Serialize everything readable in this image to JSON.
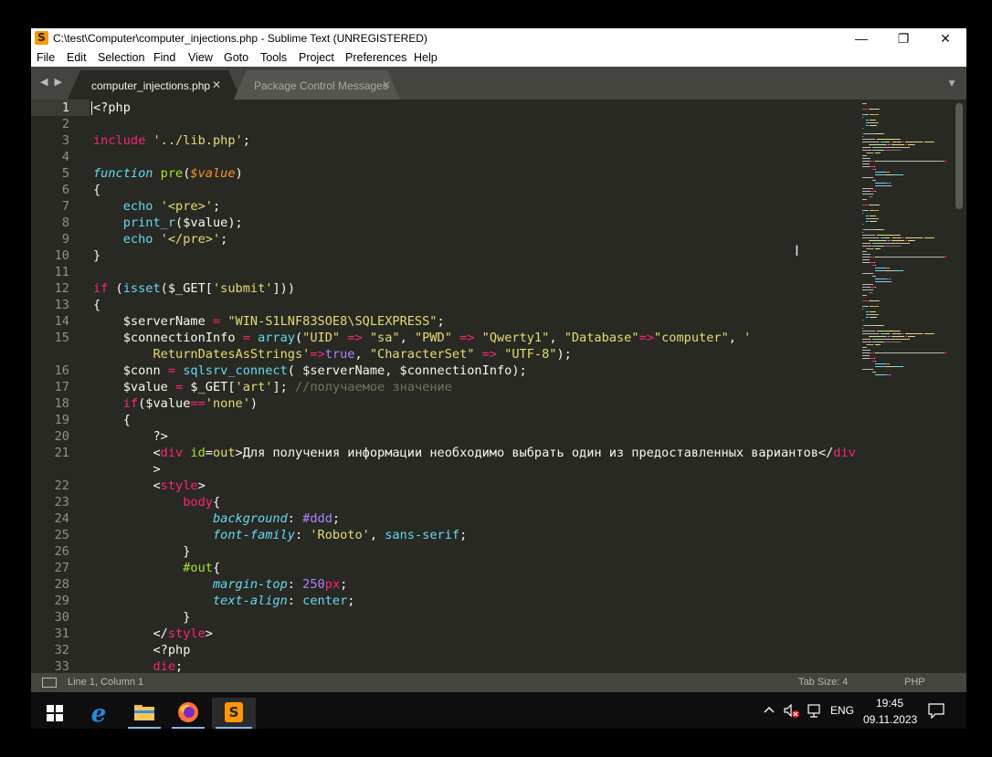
{
  "window": {
    "title": "C:\\test\\Computer\\computer_injections.php - Sublime Text (UNREGISTERED)",
    "app_icon_glyph": "S",
    "controls": {
      "minimize": "—",
      "maximize": "❐",
      "close": "✕"
    }
  },
  "menu": [
    "File",
    "Edit",
    "Selection",
    "Find",
    "View",
    "Goto",
    "Tools",
    "Project",
    "Preferences",
    "Help"
  ],
  "tabs": [
    {
      "label": "computer_injections.php",
      "close": "✕",
      "active": true
    },
    {
      "label": "Package Control Messages",
      "close": "✕",
      "active": false
    }
  ],
  "tabbar": {
    "nav": "◀ ▶",
    "menu": "▼"
  },
  "editor": {
    "lines": [
      {
        "n": "1",
        "tokens": [
          [
            "tx",
            "<?php"
          ]
        ]
      },
      {
        "n": "2",
        "tokens": []
      },
      {
        "n": "3",
        "tokens": [
          [
            "kw",
            "include"
          ],
          [
            "tx",
            " "
          ],
          [
            "st",
            "'../lib.php'"
          ],
          [
            "tx",
            ";"
          ]
        ]
      },
      {
        "n": "4",
        "tokens": []
      },
      {
        "n": "5",
        "tokens": [
          [
            "ps",
            "function"
          ],
          [
            "tx",
            " "
          ],
          [
            "fu",
            "pre"
          ],
          [
            "tx",
            "("
          ],
          [
            "vr",
            "$value"
          ],
          [
            "tx",
            ")"
          ]
        ]
      },
      {
        "n": "6",
        "tokens": [
          [
            "tx",
            "{"
          ]
        ]
      },
      {
        "n": "7",
        "tokens": [
          [
            "tx",
            "    "
          ],
          [
            "fn",
            "echo"
          ],
          [
            "tx",
            " "
          ],
          [
            "st",
            "'<pre>'"
          ],
          [
            "tx",
            ";"
          ]
        ]
      },
      {
        "n": "8",
        "tokens": [
          [
            "tx",
            "    "
          ],
          [
            "fn",
            "print_r"
          ],
          [
            "tx",
            "($value);"
          ]
        ]
      },
      {
        "n": "9",
        "tokens": [
          [
            "tx",
            "    "
          ],
          [
            "fn",
            "echo"
          ],
          [
            "tx",
            " "
          ],
          [
            "st",
            "'</pre>'"
          ],
          [
            "tx",
            ";"
          ]
        ]
      },
      {
        "n": "10",
        "tokens": [
          [
            "tx",
            "}"
          ]
        ]
      },
      {
        "n": "11",
        "tokens": []
      },
      {
        "n": "12",
        "tokens": [
          [
            "kw",
            "if"
          ],
          [
            "tx",
            " ("
          ],
          [
            "fn",
            "isset"
          ],
          [
            "tx",
            "($_GET["
          ],
          [
            "st",
            "'submit'"
          ],
          [
            "tx",
            "]))"
          ]
        ]
      },
      {
        "n": "13",
        "tokens": [
          [
            "tx",
            "{"
          ]
        ]
      },
      {
        "n": "14",
        "tokens": [
          [
            "tx",
            "    $serverName "
          ],
          [
            "kw",
            "="
          ],
          [
            "tx",
            " "
          ],
          [
            "st",
            "\"WIN-S1LNF83SOE8\\SQLEXPRESS\""
          ],
          [
            "tx",
            ";"
          ]
        ]
      },
      {
        "n": "15",
        "tokens": [
          [
            "tx",
            "    $connectionInfo "
          ],
          [
            "kw",
            "="
          ],
          [
            "tx",
            " "
          ],
          [
            "fn",
            "array"
          ],
          [
            "tx",
            "("
          ],
          [
            "st",
            "\"UID\""
          ],
          [
            "tx",
            " "
          ],
          [
            "kw",
            "=>"
          ],
          [
            "tx",
            " "
          ],
          [
            "st",
            "\"sa\""
          ],
          [
            "tx",
            ", "
          ],
          [
            "st",
            "\"PWD\""
          ],
          [
            "tx",
            " "
          ],
          [
            "kw",
            "=>"
          ],
          [
            "tx",
            " "
          ],
          [
            "st",
            "\"Qwerty1\""
          ],
          [
            "tx",
            ", "
          ],
          [
            "st",
            "\"Database\""
          ],
          [
            "kw",
            "=>"
          ],
          [
            "st",
            "\"computer\""
          ],
          [
            "tx",
            ", "
          ],
          [
            "st",
            "'"
          ]
        ]
      },
      {
        "n": "",
        "tokens": [
          [
            "tx",
            "        "
          ],
          [
            "st",
            "ReturnDatesAsStrings'"
          ],
          [
            "kw",
            "=>"
          ],
          [
            "nm",
            "true"
          ],
          [
            "tx",
            ", "
          ],
          [
            "st",
            "\"CharacterSet\""
          ],
          [
            "tx",
            " "
          ],
          [
            "kw",
            "=>"
          ],
          [
            "tx",
            " "
          ],
          [
            "st",
            "\"UTF-8\""
          ],
          [
            "tx",
            ");"
          ]
        ]
      },
      {
        "n": "16",
        "tokens": [
          [
            "tx",
            "    $conn "
          ],
          [
            "kw",
            "="
          ],
          [
            "tx",
            " "
          ],
          [
            "fn",
            "sqlsrv_connect"
          ],
          [
            "tx",
            "( $serverName, $connectionInfo);"
          ]
        ]
      },
      {
        "n": "17",
        "tokens": [
          [
            "tx",
            "    $value "
          ],
          [
            "kw",
            "="
          ],
          [
            "tx",
            " $_GET["
          ],
          [
            "st",
            "'art'"
          ],
          [
            "tx",
            "]; "
          ],
          [
            "cm",
            "//получаемое значение"
          ]
        ]
      },
      {
        "n": "18",
        "tokens": [
          [
            "tx",
            "    "
          ],
          [
            "kw",
            "if"
          ],
          [
            "tx",
            "($value"
          ],
          [
            "kw",
            "=="
          ],
          [
            "st",
            "'none'"
          ],
          [
            "tx",
            ")"
          ]
        ]
      },
      {
        "n": "19",
        "tokens": [
          [
            "tx",
            "    {"
          ]
        ]
      },
      {
        "n": "20",
        "tokens": [
          [
            "tx",
            "        ?>"
          ]
        ]
      },
      {
        "n": "21",
        "tokens": [
          [
            "tx",
            "        <"
          ],
          [
            "kw",
            "div"
          ],
          [
            "tx",
            " "
          ],
          [
            "at",
            "id"
          ],
          [
            "tx",
            "="
          ],
          [
            "st",
            "out"
          ],
          [
            "tx",
            ">Для получения информации необходимо выбрать один из предоставленных вариантов</"
          ],
          [
            "kw",
            "div"
          ]
        ]
      },
      {
        "n": "",
        "tokens": [
          [
            "tx",
            "        >"
          ]
        ]
      },
      {
        "n": "22",
        "tokens": [
          [
            "tx",
            "        <"
          ],
          [
            "kw",
            "style"
          ],
          [
            "tx",
            ">"
          ]
        ]
      },
      {
        "n": "23",
        "tokens": [
          [
            "tx",
            "            "
          ],
          [
            "kw",
            "body"
          ],
          [
            "tx",
            "{"
          ]
        ]
      },
      {
        "n": "24",
        "tokens": [
          [
            "tx",
            "                "
          ],
          [
            "ps",
            "background"
          ],
          [
            "tx",
            ": "
          ],
          [
            "nm",
            "#ddd"
          ],
          [
            "tx",
            ";"
          ]
        ]
      },
      {
        "n": "25",
        "tokens": [
          [
            "tx",
            "                "
          ],
          [
            "ps",
            "font-family"
          ],
          [
            "tx",
            ": "
          ],
          [
            "st",
            "'Roboto'"
          ],
          [
            "tx",
            ", "
          ],
          [
            "fn",
            "sans-serif"
          ],
          [
            "tx",
            ";"
          ]
        ]
      },
      {
        "n": "26",
        "tokens": [
          [
            "tx",
            "            }"
          ]
        ]
      },
      {
        "n": "27",
        "tokens": [
          [
            "tx",
            "            "
          ],
          [
            "fu",
            "#out"
          ],
          [
            "tx",
            "{"
          ]
        ]
      },
      {
        "n": "28",
        "tokens": [
          [
            "tx",
            "                "
          ],
          [
            "ps",
            "margin-top"
          ],
          [
            "tx",
            ": "
          ],
          [
            "nm",
            "250"
          ],
          [
            "kw",
            "px"
          ],
          [
            "tx",
            ";"
          ]
        ]
      },
      {
        "n": "29",
        "tokens": [
          [
            "tx",
            "                "
          ],
          [
            "ps",
            "text-align"
          ],
          [
            "tx",
            ": "
          ],
          [
            "fn",
            "center"
          ],
          [
            "tx",
            ";"
          ]
        ]
      },
      {
        "n": "30",
        "tokens": [
          [
            "tx",
            "            }"
          ]
        ]
      },
      {
        "n": "31",
        "tokens": [
          [
            "tx",
            "        </"
          ],
          [
            "kw",
            "style"
          ],
          [
            "tx",
            ">"
          ]
        ]
      },
      {
        "n": "32",
        "tokens": [
          [
            "tx",
            "        <?php"
          ]
        ]
      },
      {
        "n": "33",
        "tokens": [
          [
            "tx",
            "        "
          ],
          [
            "kw",
            "die"
          ],
          [
            "tx",
            ";"
          ]
        ]
      }
    ]
  },
  "status": {
    "position": "Line 1, Column 1",
    "tab_size": "Tab Size: 4",
    "syntax": "PHP"
  },
  "taskbar": {
    "icons": [
      "windows-start-icon",
      "internet-explorer-icon",
      "file-explorer-icon",
      "firefox-icon",
      "sublime-text-icon"
    ],
    "language": "ENG",
    "time": "19:45",
    "date": "09.11.2023"
  },
  "colors": {
    "editor_bg": "#282923",
    "keyword": "#f92672",
    "string": "#e6db74",
    "builtin": "#66d9ef",
    "number": "#ae81ff",
    "comment": "#75715e",
    "function": "#a6e22e",
    "text": "#f8f8f2"
  }
}
